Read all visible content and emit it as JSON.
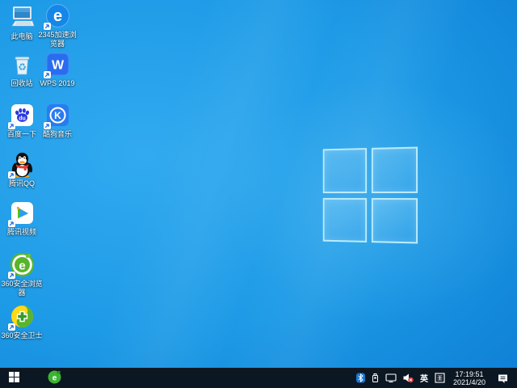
{
  "desktop": {
    "wallpaper": "windows10-default-light",
    "icons": [
      {
        "name": "this-pc",
        "icon": "computer-icon",
        "label": "此电脑",
        "shortcut": false
      },
      {
        "name": "2345-browser",
        "icon": "2345-browser-icon",
        "label": "2345加速浏览器",
        "shortcut": true
      },
      {
        "name": "recycle-bin",
        "icon": "recycle-bin-icon",
        "label": "回收站",
        "shortcut": false
      },
      {
        "name": "wps-2019",
        "icon": "wps-icon",
        "label": "WPS 2019",
        "shortcut": true
      },
      {
        "name": "baidu",
        "icon": "baidu-paw-icon",
        "label": "百度一下",
        "shortcut": true
      },
      {
        "name": "kugou-music",
        "icon": "kugou-k-icon",
        "label": "酷狗音乐",
        "shortcut": true
      },
      {
        "name": "tencent-qq",
        "icon": "qq-penguin-icon",
        "label": "腾讯QQ",
        "shortcut": true
      },
      {
        "name": "tencent-video",
        "icon": "play-triangle-icon",
        "label": "腾讯视频",
        "shortcut": true
      },
      {
        "name": "360-browser",
        "icon": "green-e-icon",
        "label": "360安全浏览器",
        "shortcut": true
      },
      {
        "name": "360-safety",
        "icon": "green-cross-icon",
        "label": "360安全卫士",
        "shortcut": true
      }
    ]
  },
  "taskbar": {
    "start": {
      "icon": "windows-logo-icon"
    },
    "pinned": [
      {
        "name": "360-browser-taskbar",
        "icon": "green-e-icon"
      }
    ],
    "tray": {
      "icons": [
        "bluetooth-icon",
        "usb-device-icon",
        "display-network-icon",
        "volume-muted-icon",
        "ime-pad-icon",
        "action-center-icon"
      ],
      "ime_language": "英",
      "time": "17:19:51",
      "date": "2021/4/20"
    }
  },
  "colors": {
    "wallpaper_center": "#31aaf0",
    "wallpaper_edge": "#1342c6",
    "taskbar_bg": "#0b1723",
    "label_text": "#ffffff",
    "bluetooth_blue": "#1877d2",
    "mute_badge_red": "#e03a3a"
  }
}
